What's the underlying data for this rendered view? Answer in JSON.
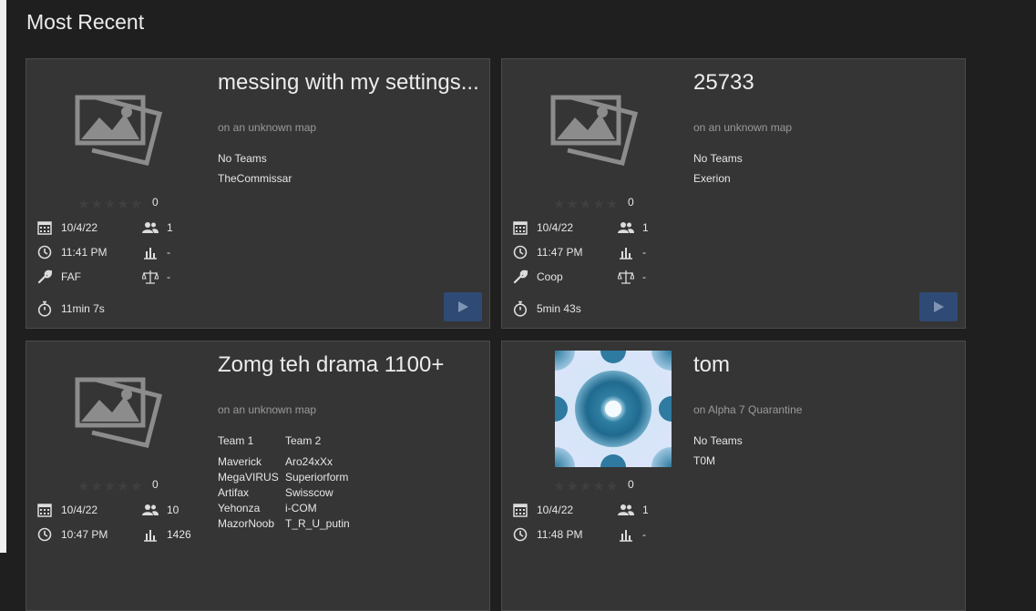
{
  "section_title": "Most Recent",
  "cards": [
    {
      "title": "messing with my settings...",
      "map": "on an unknown map",
      "team_mode": "No Teams",
      "players": [
        "TheCommissar"
      ],
      "rating": "0",
      "date": "10/4/22",
      "player_count": "1",
      "time": "11:41 PM",
      "rating_stat": "-",
      "mod": "FAF",
      "balance": "-",
      "duration": "11min 7s"
    },
    {
      "title": "25733",
      "map": "on an unknown map",
      "team_mode": "No Teams",
      "players": [
        "Exerion"
      ],
      "rating": "0",
      "date": "10/4/22",
      "player_count": "1",
      "time": "11:47 PM",
      "rating_stat": "-",
      "mod": "Coop",
      "balance": "-",
      "duration": "5min 43s"
    },
    {
      "title": "Zomg teh drama 1100+",
      "map": "on an unknown map",
      "team1_label": "Team 1",
      "team2_label": "Team 2",
      "team1": [
        "Maverick",
        "MegaVIRUS",
        "Artifax",
        "Yehonza",
        "MazorNoob"
      ],
      "team2": [
        "Aro24xXx",
        "Superiorform",
        "Swisscow",
        "i-COM",
        "T_R_U_putin"
      ],
      "rating": "0",
      "date": "10/4/22",
      "player_count": "10",
      "time": "10:47 PM",
      "rating_stat": "1426"
    },
    {
      "title": "tom",
      "map": "on Alpha 7 Quarantine",
      "team_mode": "No Teams",
      "players": [
        "T0M"
      ],
      "rating": "0",
      "date": "10/4/22",
      "player_count": "1",
      "time": "11:48 PM",
      "rating_stat": "-"
    }
  ],
  "icons": {
    "calendar": "calendar-icon",
    "players": "players-icon",
    "clock": "clock-icon",
    "rating": "rating-chart-icon",
    "mod": "wrench-icon",
    "balance": "balance-scale-icon",
    "duration": "stopwatch-icon",
    "play": "play-icon"
  },
  "colors": {
    "background": "#1f1f1f",
    "card": "#353535",
    "play_button": "#2f4a74",
    "muted_text": "#9a9a9a"
  }
}
